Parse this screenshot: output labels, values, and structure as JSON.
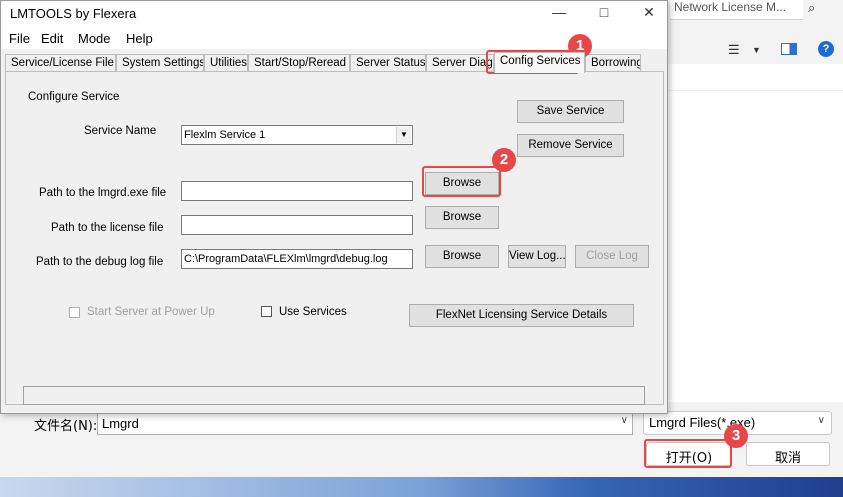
{
  "file_dialog": {
    "address_text": "Network License M...",
    "view_icon": "☰",
    "filename_label": "文件名(N):",
    "filename_value": "Lmgrd",
    "filetype_value": "Lmgrd Files(*.exe)",
    "open_label": "打开(O)",
    "cancel_label": "取消"
  },
  "lmtools": {
    "title": "LMTOOLS by Flexera",
    "menu": [
      "File",
      "Edit",
      "Mode",
      "Help"
    ],
    "tabs": [
      "Service/License File",
      "System Settings",
      "Utilities",
      "Start/Stop/Reread",
      "Server Status",
      "Server Diags",
      "Config Services",
      "Borrowing"
    ],
    "active_tab": "Config Services",
    "group_label": "Configure Service",
    "service_name_label": "Service Name",
    "service_name_value": "Flexlm Service 1",
    "save_service": "Save Service",
    "remove_service": "Remove Service",
    "lmgrd_label": "Path to the lmgrd.exe file",
    "lmgrd_value": "",
    "license_label": "Path to the license file",
    "license_value": "",
    "debug_label": "Path to the debug log file",
    "debug_value": "C:\\ProgramData\\FLEXlm\\lmgrd\\debug.log",
    "browse": "Browse",
    "view_log": "View Log...",
    "close_log": "Close Log",
    "start_at_power_up": "Start Server at Power Up",
    "use_services": "Use Services",
    "flexnet_details": "FlexNet Licensing Service Details"
  },
  "annotations": [
    "1",
    "2",
    "3"
  ],
  "colors": {
    "highlight": "#e8474a"
  }
}
